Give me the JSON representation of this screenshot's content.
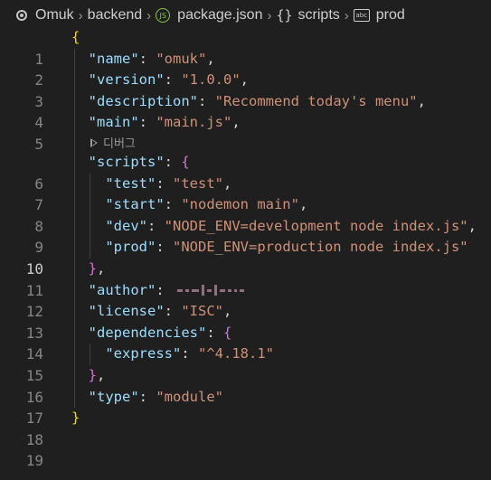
{
  "breadcrumb": {
    "items": [
      "Omuk",
      "backend",
      "package.json",
      "scripts",
      "prod"
    ],
    "js_icon_label": "JS",
    "braces_glyph": "{}",
    "abc_icon_label": "abc"
  },
  "codelens": {
    "debug_label": "디버그"
  },
  "lines": {
    "n1": "1",
    "n2": "2",
    "n3": "3",
    "n4": "4",
    "n5": "5",
    "n6": "6",
    "n7": "7",
    "n8": "8",
    "n9": "9",
    "n10": "10",
    "n11": "11",
    "n12": "12",
    "n13": "13",
    "n14": "14",
    "n15": "15",
    "n16": "16",
    "n17": "17",
    "n18": "18",
    "n19": "19"
  },
  "code": {
    "name_key": "\"name\"",
    "name_val": "\"omuk\"",
    "version_key": "\"version\"",
    "version_val": "\"1.0.0\"",
    "description_key": "\"description\"",
    "description_val": "\"Recommend today's menu\"",
    "main_key": "\"main\"",
    "main_val": "\"main.js\"",
    "scripts_key": "\"scripts\"",
    "test_key": "\"test\"",
    "test_val": "\"test\"",
    "start_key": "\"start\"",
    "start_val": "\"nodemon main\"",
    "dev_key": "\"dev\"",
    "dev_val": "\"NODE_ENV=development node index.js\"",
    "prod_key": "\"prod\"",
    "prod_val": "\"NODE_ENV=production node index.js\"",
    "author_key": "\"author\"",
    "license_key": "\"license\"",
    "license_val": "\"ISC\"",
    "dependencies_key": "\"dependencies\"",
    "express_key": "\"express\"",
    "express_val": "\"^4.18.1\"",
    "type_key": "\"type\"",
    "type_val": "\"module\""
  },
  "active_line": 10,
  "colors": {
    "background": "#1f1f1f",
    "key": "#9cdcfe",
    "string": "#ce9178",
    "brace_level1": "#ffd700",
    "brace_level2": "#da70d6"
  }
}
